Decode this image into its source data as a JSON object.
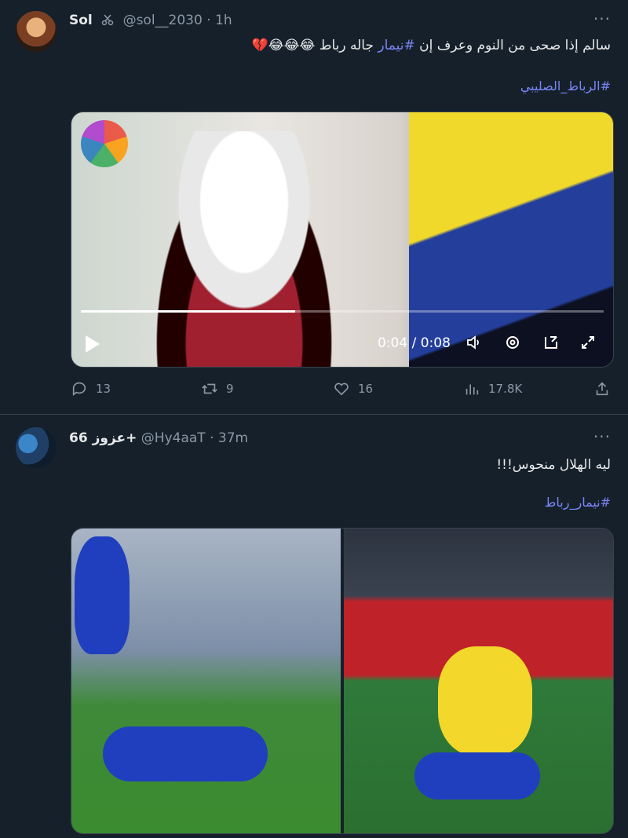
{
  "tweets": [
    {
      "author": {
        "name": "Sol",
        "handle": "@sol__2030",
        "time": "1h",
        "badge_icon": "scissors-icon"
      },
      "text": {
        "prefix": "سالم إذا صحى من النوم وعرف إن ",
        "hashtag": "#نيمار",
        "suffix": " جاله رباط 😂😂😂💔"
      },
      "tagline": "#الرباط_الصليبي",
      "video": {
        "time": "0:04 / 0:08",
        "progress": 0.41
      },
      "stats": {
        "replies": "13",
        "retweets": "9",
        "likes": "16",
        "views": "17.8K"
      }
    },
    {
      "author": {
        "name": "عزوز 66+",
        "handle": "@Hy4aaT",
        "time": "37m"
      },
      "text": {
        "full": "ليه الهلال منحوس!!!"
      },
      "tagline": "#نيمار_رباط"
    }
  ],
  "colors": {
    "background": "#15202b",
    "accent": "#7b86f5",
    "muted": "#8b98a5",
    "divider": "#38444d"
  }
}
